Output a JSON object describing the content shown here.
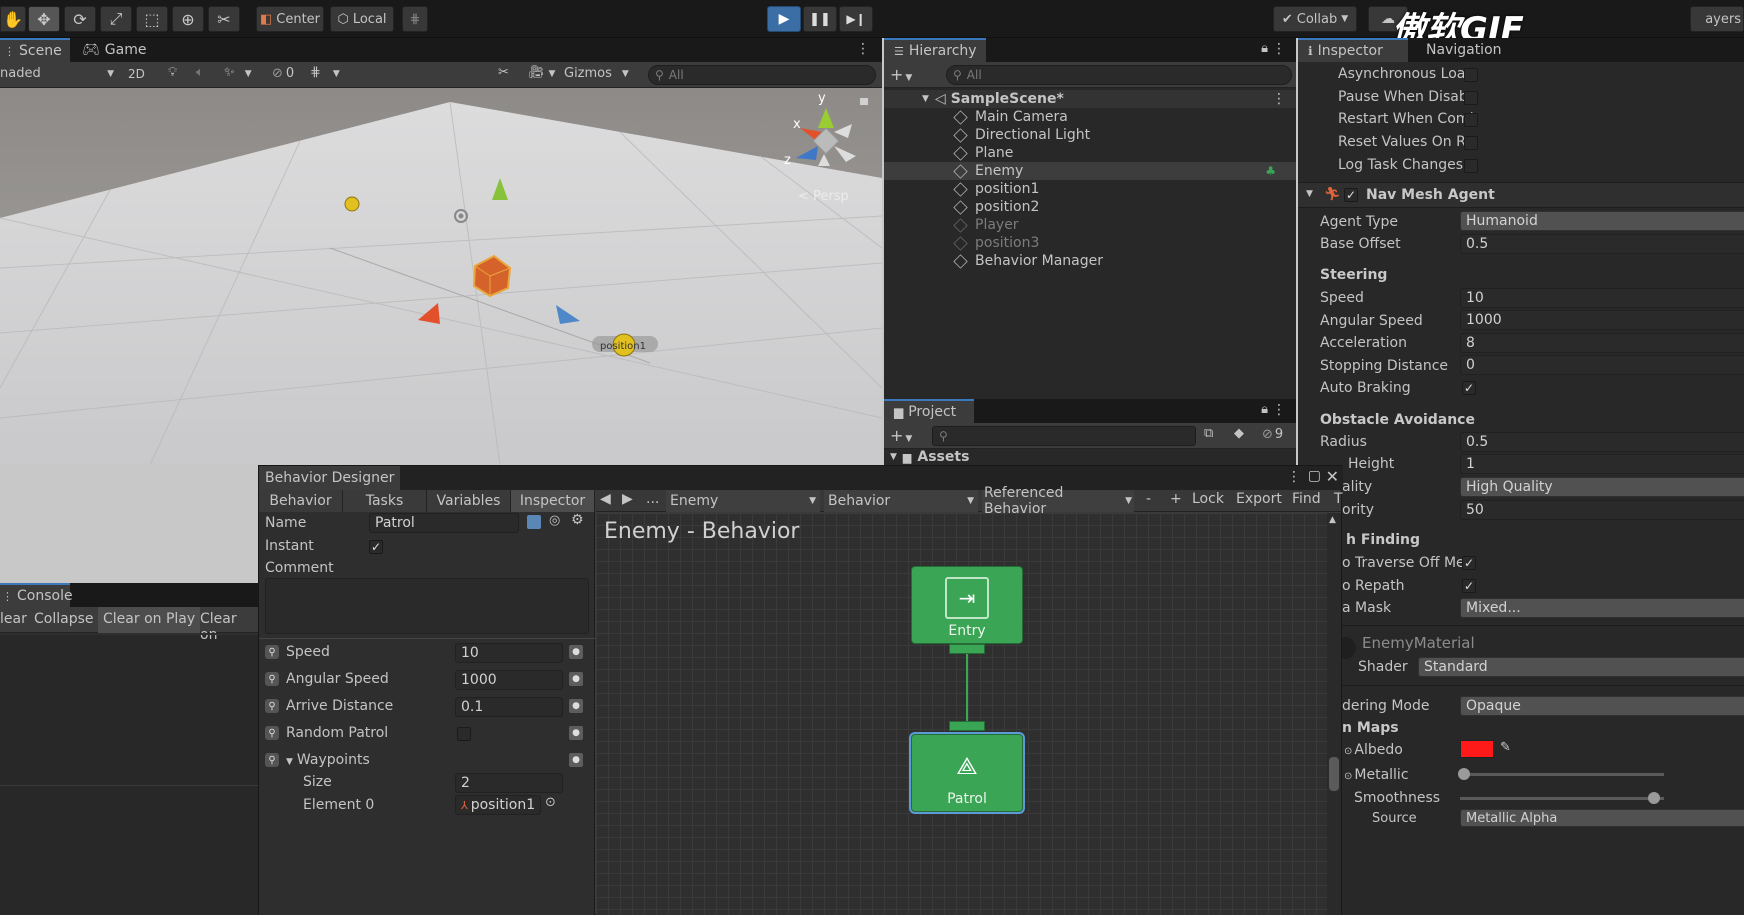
{
  "toolbar": {
    "pivot_label": "Center",
    "space_label": "Local",
    "collab_label": "Collab",
    "layers_label": "ayers",
    "watermark": "傲软GIF"
  },
  "scene": {
    "tab_scene": "Scene",
    "tab_game": "Game",
    "shading_mode": "naded",
    "mode_2d": "2D",
    "hidden_count": "0",
    "gizmos_label": "Gizmos",
    "search_placeholder": "All",
    "persp_label": "< Persp",
    "gizmo_axes": {
      "x": "x",
      "y": "y",
      "z": "z"
    },
    "object_label": "position1"
  },
  "hierarchy": {
    "title": "Hierarchy",
    "search_placeholder": "All",
    "scene_name": "SampleScene*",
    "items": [
      {
        "label": "Main Camera"
      },
      {
        "label": "Directional Light"
      },
      {
        "label": "Plane"
      },
      {
        "label": "Enemy"
      },
      {
        "label": "position1"
      },
      {
        "label": "position2"
      },
      {
        "label": "Player"
      },
      {
        "label": "position3"
      },
      {
        "label": "Behavior Manager"
      }
    ]
  },
  "project": {
    "title": "Project",
    "hidden_count": "9",
    "assets_label": "Assets"
  },
  "console": {
    "title": "Console",
    "buttons": [
      "lear",
      "Collapse",
      "Clear on Play",
      "Clear on"
    ]
  },
  "inspector": {
    "title": "Inspector",
    "tab_navigation": "Navigation",
    "behavior_tree_rows": [
      "Asynchronous Loa",
      "Pause When Disab",
      "Restart When Com|",
      "Reset Values On R",
      "Log Task Changes"
    ],
    "navmesh_title": "Nav Mesh Agent",
    "fields": {
      "agent_type": {
        "label": "Agent Type",
        "value": "Humanoid"
      },
      "base_offset": {
        "label": "Base Offset",
        "value": "0.5"
      },
      "steering_header": "Steering",
      "speed": {
        "label": "Speed",
        "value": "10"
      },
      "angular_speed": {
        "label": "Angular Speed",
        "value": "1000"
      },
      "acceleration": {
        "label": "Acceleration",
        "value": "8"
      },
      "stopping_distance": {
        "label": "Stopping Distance",
        "value": "0"
      },
      "auto_braking": {
        "label": "Auto Braking",
        "value": "✓"
      },
      "obstacle_header": "Obstacle Avoidance",
      "radius": {
        "label": "Radius",
        "value": "0.5"
      },
      "height": {
        "label": "Height",
        "value": "1"
      },
      "quality": {
        "label": "ality",
        "value": "High Quality"
      },
      "priority": {
        "label": "ority",
        "value": "50"
      },
      "pathfinding_header": "h Finding",
      "auto_traverse": {
        "label": "o Traverse Off Me",
        "value": "✓"
      },
      "auto_repath": {
        "label": "o Repath",
        "value": "✓"
      },
      "area_mask": {
        "label": "a Mask",
        "value": "Mixed..."
      }
    },
    "material": {
      "name": "EnemyMaterial",
      "shader_label": "Shader",
      "shader_value": "Standard",
      "rendering_mode_label": "dering Mode",
      "rendering_mode_value": "Opaque",
      "maps_header": "n Maps",
      "albedo_label": "Albedo",
      "albedo_color": "#ff1a1a",
      "metallic_label": "Metallic",
      "metallic_level": 0.02,
      "smoothness_label": "Smoothness",
      "smoothness_level": 0.95,
      "source_label": "Source",
      "source_value": "Metallic Alpha"
    }
  },
  "behavior_designer": {
    "title": "Behavior Designer",
    "tabs": [
      "Behavior",
      "Tasks",
      "Variables",
      "Inspector"
    ],
    "nav": {
      "back": "◀",
      "forward": "▶",
      "more": "...",
      "object_dropdown": "Enemy",
      "behavior_dropdown": "Behavior",
      "referenced_dropdown": "Referenced Behavior",
      "minus": "-",
      "plus": "+",
      "lock": "Lock",
      "export": "Export",
      "find": "Find",
      "truncated": "T"
    },
    "task": {
      "name_label": "Name",
      "name_value": "Patrol",
      "instant_label": "Instant",
      "instant_value": "✓",
      "comment_label": "Comment"
    },
    "variables": [
      {
        "label": "Speed",
        "value": "10"
      },
      {
        "label": "Angular Speed",
        "value": "1000"
      },
      {
        "label": "Arrive Distance",
        "value": "0.1"
      },
      {
        "label": "Random Patrol",
        "value": ""
      }
    ],
    "waypoints": {
      "label": "Waypoints",
      "size_label": "Size",
      "size_value": "2",
      "element0_label": "Element 0",
      "element0_value": "position1"
    },
    "graph_title": "Enemy - Behavior",
    "nodes": {
      "entry": "Entry",
      "patrol": "Patrol"
    }
  }
}
